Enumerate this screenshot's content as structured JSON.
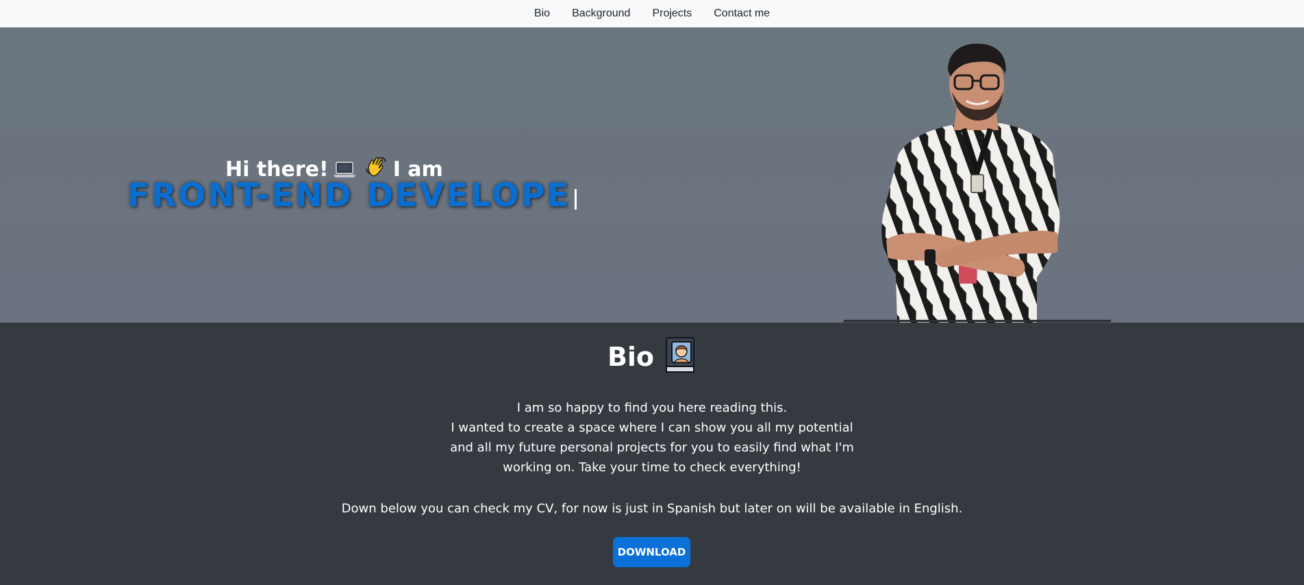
{
  "nav": {
    "items": [
      {
        "label": "Bio"
      },
      {
        "label": "Background"
      },
      {
        "label": "Projects"
      },
      {
        "label": "Contact me"
      }
    ]
  },
  "hero": {
    "greeting_pre": "Hi there!",
    "greeting_post": "I am",
    "role": "FRONT-END DEVELOPE",
    "icons": [
      "laptop-icon",
      "waving-hand-icon"
    ],
    "role_color": "#0a6ed1"
  },
  "bio": {
    "title": "Bio",
    "title_icon": "book-portrait-icon",
    "paragraph_lines": [
      "I am so happy to find you here reading this.",
      "I wanted to create a space where I can show you all my potential",
      "and all my future personal projects for you to easily find what I'm",
      "working on. Take your time to check everything!"
    ],
    "cv_text": "Down below you can check my CV, for now is just in Spanish but later on will be available in English.",
    "download_label": "DOWNLOAD",
    "button_color": "#0a71d9"
  }
}
